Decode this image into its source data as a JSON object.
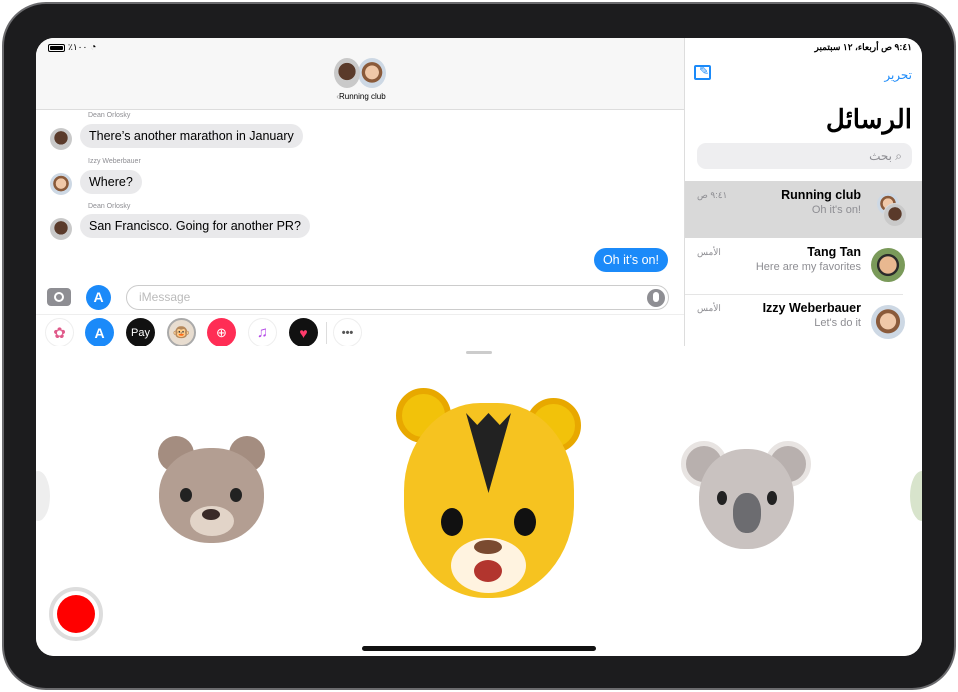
{
  "status_bar": {
    "battery": "٪١٠٠",
    "time_date": "٩:٤١ ص  أربعاء، ١٢ سبتمبر"
  },
  "conversation": {
    "title": "Running club",
    "messages": [
      {
        "sender": "Dean Orlosky",
        "text": "There’s another marathon in January",
        "outgoing": false
      },
      {
        "sender": "Izzy Weberbauer",
        "text": "Where?",
        "outgoing": false
      },
      {
        "sender": "Dean Orlosky",
        "text": "San Francisco. Going for another PR?",
        "outgoing": false
      },
      {
        "sender": "",
        "text": "Oh it’s on!",
        "outgoing": true
      }
    ],
    "input_placeholder": "iMessage",
    "apps": [
      "photos-icon",
      "app-store-icon",
      "apple-pay-icon",
      "animoji-icon",
      "web-images-icon",
      "music-icon",
      "digital-touch-icon",
      "more-icon"
    ],
    "apple_pay_label": "Pay"
  },
  "sidebar": {
    "edit_label": "تحرير",
    "title": "الرسائل",
    "search_placeholder": "بحث",
    "conversations": [
      {
        "name": "Running club",
        "preview": "Oh it's on!",
        "time": "٩:٤١ ص",
        "selected": true
      },
      {
        "name": "Tang Tan",
        "preview": "Here are my favorites",
        "time": "الأمس",
        "selected": false
      },
      {
        "name": "Izzy Weberbauer",
        "preview": "Let's do it",
        "time": "الأمس",
        "selected": false
      }
    ]
  },
  "animoji": {
    "characters": [
      "bear",
      "tiger",
      "koala"
    ],
    "selected": "tiger"
  },
  "colors": {
    "accent": "#1b8af9",
    "record": "#ff0000",
    "selected_row": "#d9d9d9"
  }
}
